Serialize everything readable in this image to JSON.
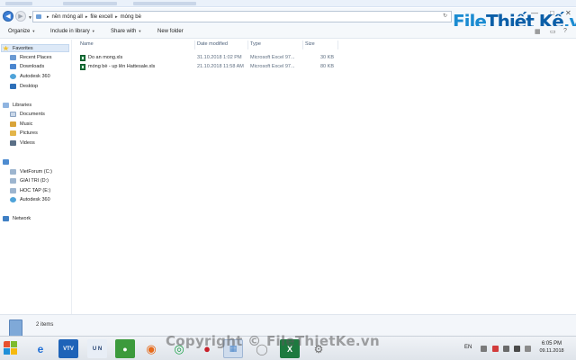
{
  "address_bar": {
    "breadcrumbs": [
      "nền móng all",
      "file excell",
      "móng bè"
    ]
  },
  "logo": {
    "part1": "File",
    "part2": "Thiết Kế",
    "part3": ".vn"
  },
  "toolbar": {
    "organize_label": "Organize",
    "include_label": "Include in library",
    "share_label": "Share with",
    "new_folder_label": "New folder"
  },
  "nav": {
    "favorites_label": "Favorites",
    "favorites": [
      "Recent Places",
      "Downloads",
      "Autodesk 360",
      "Desktop"
    ],
    "libraries_label": "Libraries",
    "libraries": [
      "Documents",
      "Music",
      "Pictures",
      "Videos"
    ],
    "drives": [
      "VietForum (C:)",
      "GIAI TRI (D:)",
      "HOC TAP (E:)",
      "Autodesk 360"
    ],
    "network_label": "Network"
  },
  "file_list": {
    "columns": [
      "Name",
      "Date modified",
      "Type",
      "Size"
    ],
    "rows": [
      {
        "name": "Do an mong.xls",
        "date": "31.10.2018 1:02 PM",
        "type": "Microsoft Excel 97...",
        "size": "30 KB"
      },
      {
        "name": "móng bè - up lên Hattesale.xls",
        "date": "21.10.2018 11:58 AM",
        "type": "Microsoft Excel 97...",
        "size": "80 KB"
      }
    ]
  },
  "status": {
    "item_count": "2 items"
  },
  "taskbar": {
    "language": "EN",
    "time": "6:05 PM",
    "date": "09.11.2018"
  },
  "watermark": {
    "text": "Copyright © FileThietKe.vn"
  },
  "colors": {
    "accent": "#3b7fd6",
    "logo_blue": "#1b8bd1",
    "excel_green": "#1d7a3f"
  }
}
